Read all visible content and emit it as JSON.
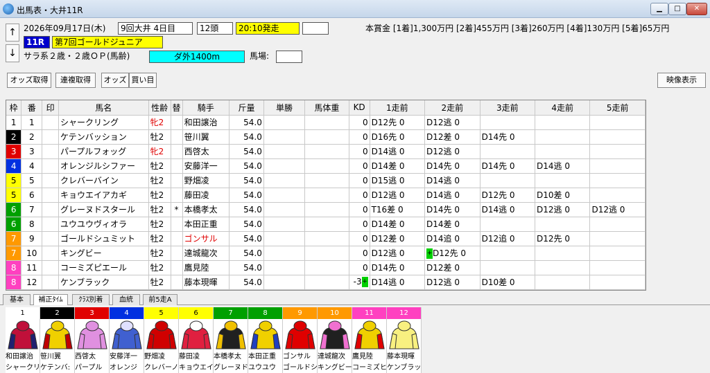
{
  "window": {
    "title": "出馬表・大井11R"
  },
  "header": {
    "date": "2026年09月17日(木)",
    "meeting": "9回大井 4日目",
    "runners": "12頭",
    "post_time": "20:10発走",
    "race_no": "11R",
    "race_name": "第7回ゴールドジュニア",
    "conditions": "サラ系２歳・２歳ＯＰ(馬齢)",
    "course": "ダ外1400m",
    "going_label": "馬場:",
    "prize": "本賞金 [1着]1,300万円 [2着]455万円 [3着]260万円 [4着]130万円 [5着]65万円"
  },
  "colors": {
    "post_time_bg": "#ffff00",
    "race_name_bg": "#ffff00",
    "race_no_bg": "#0000cc",
    "course_bg": "#00ffff"
  },
  "toolbar": {
    "odds": "オッズ取得",
    "renpuku": "連複取得",
    "odds2": "オッズ",
    "buy": "買い目",
    "video": "映像表示"
  },
  "table": {
    "columns": [
      "枠",
      "番",
      "印",
      "馬名",
      "性齢",
      "替",
      "騎手",
      "斤量",
      "単勝",
      "馬体重",
      "KD",
      "1走前",
      "2走前",
      "3走前",
      "4走前",
      "5走前"
    ],
    "rows": [
      {
        "waku": "1",
        "ban": "1",
        "name": "シャークリング",
        "sexage": "牝2",
        "sex_red": true,
        "jockey": "和田譲治",
        "jockey_red": false,
        "change": "",
        "weight": "54.0",
        "kd": "0",
        "kd_mark": "",
        "prev": [
          "D12先 0",
          "D12逃 0",
          "",
          "",
          ""
        ],
        "marks": [
          "",
          "",
          "",
          "",
          ""
        ]
      },
      {
        "waku": "2",
        "ban": "2",
        "name": "ケテンバッション",
        "sexage": "牡2",
        "sex_red": false,
        "jockey": "笹川翼",
        "jockey_red": false,
        "change": "",
        "weight": "54.0",
        "kd": "0",
        "kd_mark": "",
        "prev": [
          "D16先 0",
          "D12差 0",
          "D14先 0",
          "",
          ""
        ],
        "marks": [
          "",
          "",
          "",
          "",
          ""
        ]
      },
      {
        "waku": "3",
        "ban": "3",
        "name": "パープルフォッグ",
        "sexage": "牝2",
        "sex_red": true,
        "jockey": "西啓太",
        "jockey_red": false,
        "change": "",
        "weight": "54.0",
        "kd": "0",
        "kd_mark": "",
        "prev": [
          "D14逃 0",
          "D12逃 0",
          "",
          "",
          ""
        ],
        "marks": [
          "",
          "",
          "",
          "",
          ""
        ]
      },
      {
        "waku": "4",
        "ban": "4",
        "name": "オレンジルシファー",
        "sexage": "牡2",
        "sex_red": false,
        "jockey": "安藤洋一",
        "jockey_red": false,
        "change": "",
        "weight": "54.0",
        "kd": "0",
        "kd_mark": "",
        "prev": [
          "D14差 0",
          "D14先 0",
          "D14先 0",
          "D14逃 0",
          ""
        ],
        "marks": [
          "",
          "",
          "",
          "",
          ""
        ]
      },
      {
        "waku": "5",
        "ban": "5",
        "name": "クレバーバイン",
        "sexage": "牡2",
        "sex_red": false,
        "jockey": "野畑凌",
        "jockey_red": false,
        "change": "",
        "weight": "54.0",
        "kd": "0",
        "kd_mark": "",
        "prev": [
          "D15逃 0",
          "D14逃 0",
          "",
          "",
          ""
        ],
        "marks": [
          "",
          "",
          "",
          "",
          ""
        ]
      },
      {
        "waku": "5",
        "ban": "6",
        "name": "キョウエイアカギ",
        "sexage": "牡2",
        "sex_red": false,
        "jockey": "藤田凌",
        "jockey_red": false,
        "change": "",
        "weight": "54.0",
        "kd": "0",
        "kd_mark": "",
        "prev": [
          "D12逃 0",
          "D14逃 0",
          "D12先 0",
          "D10差 0",
          ""
        ],
        "marks": [
          "",
          "",
          "",
          "",
          ""
        ]
      },
      {
        "waku": "6",
        "ban": "7",
        "name": "グレーヌドスタール",
        "sexage": "牡2",
        "sex_red": false,
        "jockey": "本橋孝太",
        "jockey_red": false,
        "change": "*",
        "weight": "54.0",
        "kd": "0",
        "kd_mark": "",
        "prev": [
          "T16差 0",
          "D14先 0",
          "D14逃 0",
          "D12逃 0",
          "D12逃 0"
        ],
        "marks": [
          "",
          "",
          "",
          "",
          ""
        ]
      },
      {
        "waku": "6",
        "ban": "8",
        "name": "ユウユウヴィオラ",
        "sexage": "牡2",
        "sex_red": false,
        "jockey": "本田正重",
        "jockey_red": false,
        "change": "",
        "weight": "54.0",
        "kd": "0",
        "kd_mark": "",
        "prev": [
          "D14差 0",
          "D14差 0",
          "",
          "",
          ""
        ],
        "marks": [
          "",
          "",
          "",
          "",
          ""
        ]
      },
      {
        "waku": "7",
        "ban": "9",
        "name": "ゴールドシュミット",
        "sexage": "牡2",
        "sex_red": false,
        "jockey": "ゴンサル",
        "jockey_red": true,
        "change": "",
        "weight": "54.0",
        "kd": "0",
        "kd_mark": "",
        "prev": [
          "D12差 0",
          "D14追 0",
          "D12追 0",
          "D12先 0",
          ""
        ],
        "marks": [
          "",
          "",
          "",
          "",
          ""
        ]
      },
      {
        "waku": "7",
        "ban": "10",
        "name": "キングビー",
        "sexage": "牡2",
        "sex_red": false,
        "jockey": "達城龍次",
        "jockey_red": false,
        "change": "",
        "weight": "54.0",
        "kd": "0",
        "kd_mark": "",
        "prev": [
          "D12逃 0",
          "D12先 0",
          "",
          "",
          ""
        ],
        "marks": [
          "",
          "+",
          "",
          "",
          ""
        ]
      },
      {
        "waku": "8",
        "ban": "11",
        "name": "コーミズピエール",
        "sexage": "牡2",
        "sex_red": false,
        "jockey": "鷹見陸",
        "jockey_red": false,
        "change": "",
        "weight": "54.0",
        "kd": "0",
        "kd_mark": "",
        "prev": [
          "D14先 0",
          "D12差 0",
          "",
          "",
          ""
        ],
        "marks": [
          "",
          "",
          "",
          "",
          ""
        ]
      },
      {
        "waku": "8",
        "ban": "12",
        "name": "ケンブラック",
        "sexage": "牡2",
        "sex_red": false,
        "jockey": "藤本現暉",
        "jockey_red": false,
        "change": "",
        "weight": "54.0",
        "kd": "-3",
        "kd_mark": "+",
        "prev": [
          "D14逃 0",
          "D12逃 0",
          "D10差 0",
          "",
          ""
        ],
        "marks": [
          "",
          "",
          "",
          "",
          ""
        ]
      }
    ]
  },
  "waku_colors": {
    "1": [
      "#ffffff",
      "#000"
    ],
    "2": [
      "#000000",
      "#fff"
    ],
    "3": [
      "#e00000",
      "#fff"
    ],
    "4": [
      "#0030e0",
      "#fff"
    ],
    "5": [
      "#ffff00",
      "#000"
    ],
    "6": [
      "#00a000",
      "#fff"
    ],
    "7": [
      "#ff9900",
      "#fff"
    ],
    "8": [
      "#ff40c0",
      "#fff"
    ]
  },
  "tabs": [
    "基本",
    "補正ﾀｲﾑ",
    "ｸﾗｽ別着",
    "血統",
    "前5走A"
  ],
  "silks": [
    {
      "num": "1",
      "jockey": "和田譲治",
      "horse": "シャークリ",
      "shirt": "#c0103a",
      "sleeve": "#202070",
      "cap": "#c0103a"
    },
    {
      "num": "2",
      "jockey": "笹川翼",
      "horse": "ケテンバ:",
      "shirt": "#f0d000",
      "sleeve": "#c00000",
      "cap": "#f0d000"
    },
    {
      "num": "3",
      "jockey": "西啓太",
      "horse": "パープル",
      "shirt": "#e090e0",
      "sleeve": "#e090e0",
      "cap": "#e090e0"
    },
    {
      "num": "4",
      "jockey": "安藤洋一",
      "horse": "オレンジ",
      "shirt": "#4060d0",
      "sleeve": "#4060d0",
      "cap": "#e0e0ff"
    },
    {
      "num": "5",
      "jockey": "野畑凌",
      "horse": "クレバーノ",
      "shirt": "#d00000",
      "sleeve": "#d00000",
      "cap": "#d00000"
    },
    {
      "num": "6",
      "jockey": "藤田凌",
      "horse": "キョウエイ",
      "shirt": "#e02040",
      "sleeve": "#e02040",
      "cap": "#ffffff"
    },
    {
      "num": "7",
      "jockey": "本橋孝太",
      "horse": "グレーヌド",
      "shirt": "#202020",
      "sleeve": "#f0c000",
      "cap": "#f0c000"
    },
    {
      "num": "8",
      "jockey": "本田正重",
      "horse": "ユウユウ",
      "shirt": "#f0d000",
      "sleeve": "#2040c0",
      "cap": "#f0d000"
    },
    {
      "num": "9",
      "jockey": "ゴンサル",
      "horse": "ゴールドシ",
      "shirt": "#e00000",
      "sleeve": "#e00000",
      "cap": "#e00000"
    },
    {
      "num": "10",
      "jockey": "達城龍次",
      "horse": "キングビー",
      "shirt": "#202020",
      "sleeve": "#f070d0",
      "cap": "#f070d0"
    },
    {
      "num": "11",
      "jockey": "鷹見陸",
      "horse": "コーミズヒ",
      "shirt": "#f0d000",
      "sleeve": "#e00000",
      "cap": "#f0d000"
    },
    {
      "num": "12",
      "jockey": "藤本現暉",
      "horse": "ケンブラッ",
      "shirt": "#f8f080",
      "sleeve": "#f8f080",
      "cap": "#f8f080"
    }
  ]
}
